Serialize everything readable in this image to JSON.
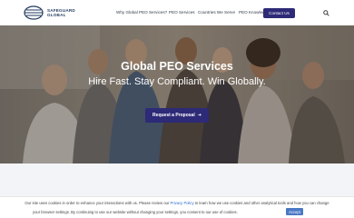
{
  "brand": {
    "line1": "SAFEGUARD",
    "line2": "GLOBAL",
    "logo_icon": "globe-lines-icon",
    "primary_color": "#2d2a77"
  },
  "nav": {
    "items": [
      {
        "label": "Why Global PEO Services?"
      },
      {
        "label": "PEO Services"
      },
      {
        "label": "Countries We Serve"
      },
      {
        "label": "PEO Knowledge Center"
      }
    ],
    "contact_label": "Contact Us",
    "search_icon": "search-icon"
  },
  "hero": {
    "title": "Global PEO Services",
    "subtitle": "Hire Fast. Stay Compliant. Win Globally.",
    "cta_label": "Request a Proposal",
    "cta_icon": "arrow-right-icon"
  },
  "cookie": {
    "text_before": "Our site uses cookies in order to enhance your interactions with us. Please review our ",
    "link": "Privacy Policy",
    "text_after": " to learn how we use cookies and other analytical tools and how you can change",
    "line2": "your browser settings. By continuing to use our website without changing your settings, you consent to our use of cookies.",
    "accept_label": "Accept"
  }
}
